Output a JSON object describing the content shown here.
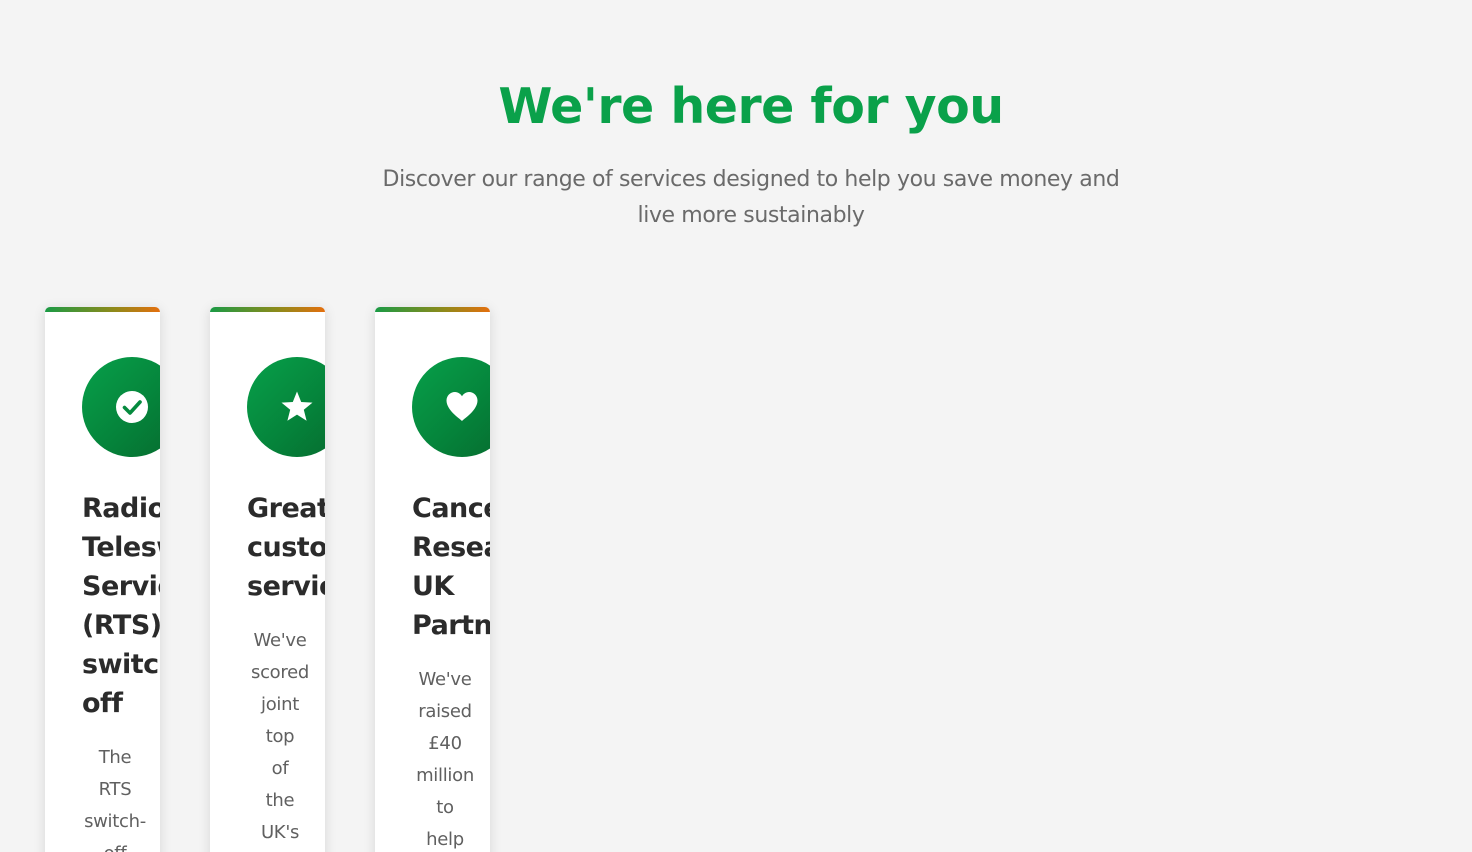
{
  "section": {
    "title": "We're here for you",
    "subtitle_line1": "Discover our range of services designed to help you save money and",
    "subtitle_line2": "live more sustainably"
  },
  "cards": [
    {
      "icon": "check-circle-icon",
      "title_lines": [
        "Radio",
        "Telesw",
        "Servic",
        "(RTS)",
        "switch",
        "off"
      ],
      "text_lines": [
        "The",
        "RTS",
        "switch-",
        "off"
      ]
    },
    {
      "icon": "star-icon",
      "title_lines": [
        "Great",
        "custor",
        "servic"
      ],
      "text_lines": [
        "We've",
        "scored",
        "joint",
        "top",
        "of",
        "the",
        "UK's"
      ]
    },
    {
      "icon": "heart-icon",
      "title_lines": [
        "Cance",
        "Resea",
        "UK",
        "Partne"
      ],
      "text_lines": [
        "We've",
        "raised",
        "£40",
        "million",
        "to",
        "help"
      ]
    }
  ],
  "colors": {
    "brand_green": "#0aa14a",
    "accent_orange": "#e46f0e",
    "background": "#f4f4f4"
  }
}
